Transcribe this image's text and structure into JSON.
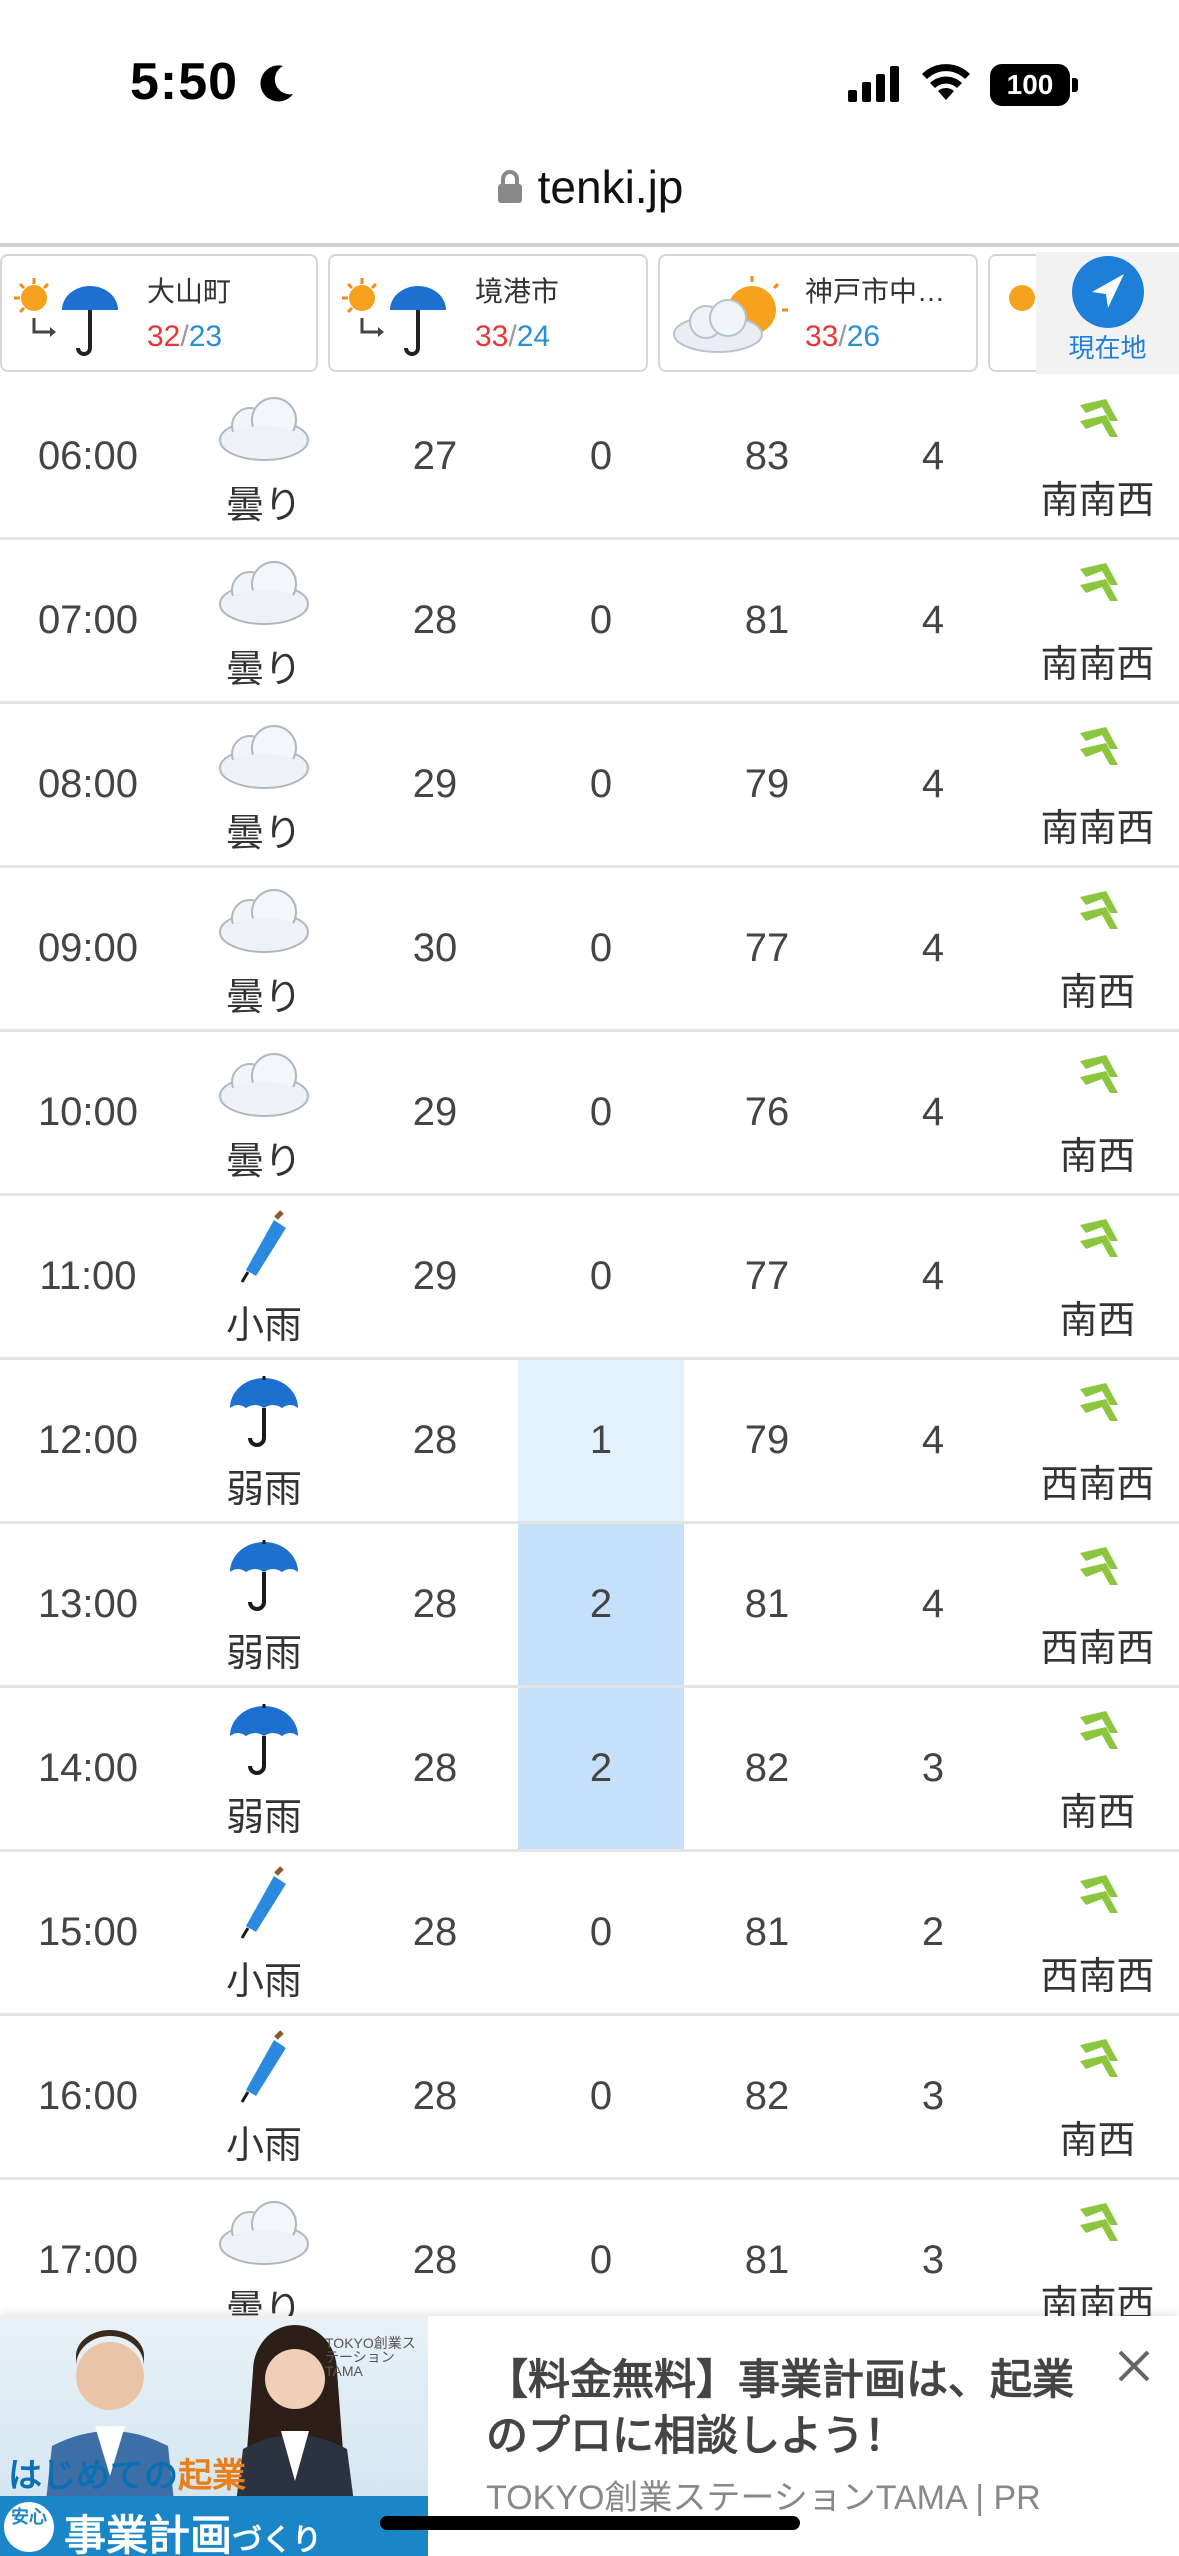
{
  "status_bar": {
    "time": "5:50",
    "battery": "100"
  },
  "browser": {
    "url": "tenki.jp"
  },
  "locations": [
    {
      "name": "大山町",
      "high": "32",
      "low": "23",
      "icon": "sun-then-umbrella-icon"
    },
    {
      "name": "境港市",
      "high": "33",
      "low": "24",
      "icon": "sun-then-umbrella-icon"
    },
    {
      "name": "神戸市中…",
      "high": "33",
      "low": "26",
      "icon": "cloud-sun-icon"
    }
  ],
  "current_location": {
    "label": "現在地"
  },
  "forecast_rows": [
    {
      "time": "06:00",
      "weather": "曇り",
      "icon": "cloud-icon",
      "temp": "27",
      "precip": "0",
      "humidity": "83",
      "wind": "4",
      "direction": "南南西"
    },
    {
      "time": "07:00",
      "weather": "曇り",
      "icon": "cloud-icon",
      "temp": "28",
      "precip": "0",
      "humidity": "81",
      "wind": "4",
      "direction": "南南西"
    },
    {
      "time": "08:00",
      "weather": "曇り",
      "icon": "cloud-icon",
      "temp": "29",
      "precip": "0",
      "humidity": "79",
      "wind": "4",
      "direction": "南南西"
    },
    {
      "time": "09:00",
      "weather": "曇り",
      "icon": "cloud-icon",
      "temp": "30",
      "precip": "0",
      "humidity": "77",
      "wind": "4",
      "direction": "南西"
    },
    {
      "time": "10:00",
      "weather": "曇り",
      "icon": "cloud-icon",
      "temp": "29",
      "precip": "0",
      "humidity": "76",
      "wind": "4",
      "direction": "南西"
    },
    {
      "time": "11:00",
      "weather": "小雨",
      "icon": "closed-umbrella-icon",
      "temp": "29",
      "precip": "0",
      "humidity": "77",
      "wind": "4",
      "direction": "南西"
    },
    {
      "time": "12:00",
      "weather": "弱雨",
      "icon": "umbrella-icon",
      "temp": "28",
      "precip": "1",
      "humidity": "79",
      "wind": "4",
      "direction": "西南西"
    },
    {
      "time": "13:00",
      "weather": "弱雨",
      "icon": "umbrella-icon",
      "temp": "28",
      "precip": "2",
      "humidity": "81",
      "wind": "4",
      "direction": "西南西"
    },
    {
      "time": "14:00",
      "weather": "弱雨",
      "icon": "umbrella-icon",
      "temp": "28",
      "precip": "2",
      "humidity": "82",
      "wind": "3",
      "direction": "南西"
    },
    {
      "time": "15:00",
      "weather": "小雨",
      "icon": "closed-umbrella-icon",
      "temp": "28",
      "precip": "0",
      "humidity": "81",
      "wind": "2",
      "direction": "西南西"
    },
    {
      "time": "16:00",
      "weather": "小雨",
      "icon": "closed-umbrella-icon",
      "temp": "28",
      "precip": "0",
      "humidity": "82",
      "wind": "3",
      "direction": "南西"
    },
    {
      "time": "17:00",
      "weather": "曇り",
      "icon": "cloud-icon",
      "temp": "28",
      "precip": "0",
      "humidity": "81",
      "wind": "3",
      "direction": "南南西"
    }
  ],
  "ad": {
    "brand": "TOKYO創業ステーションTAMA",
    "catch1_pre": "はじめての",
    "catch1_hl": "起業",
    "anshin": "安心",
    "catch2": "事業計画",
    "catch2_small": "づくり",
    "title": "【料金無料】事業計画は、起業のプロに相談しよう！",
    "source": "TOKYO創業ステーションTAMA | PR"
  },
  "colors": {
    "accent_blue": "#1e7fd8",
    "high_temp": "#e33333",
    "low_temp": "#2a8fd6",
    "wind_arrow": "#8cc63f"
  }
}
